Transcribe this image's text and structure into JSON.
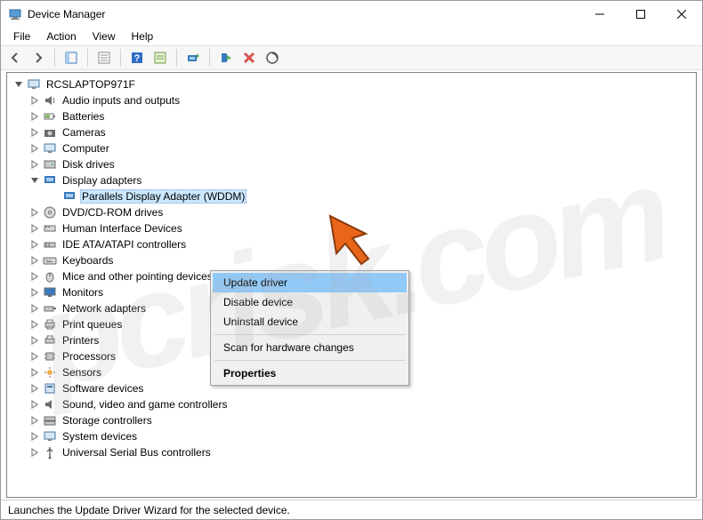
{
  "window": {
    "title": "Device Manager"
  },
  "menu": {
    "file": "File",
    "action": "Action",
    "view": "View",
    "help": "Help"
  },
  "tree": {
    "root": "RCSLAPTOP971F",
    "items": [
      "Audio inputs and outputs",
      "Batteries",
      "Cameras",
      "Computer",
      "Disk drives",
      "Display adapters",
      "DVD/CD-ROM drives",
      "Human Interface Devices",
      "IDE ATA/ATAPI controllers",
      "Keyboards",
      "Mice and other pointing devices",
      "Monitors",
      "Network adapters",
      "Print queues",
      "Printers",
      "Processors",
      "Sensors",
      "Software devices",
      "Sound, video and game controllers",
      "Storage controllers",
      "System devices",
      "Universal Serial Bus controllers"
    ],
    "display_child": "Parallels Display Adapter (WDDM)"
  },
  "context_menu": {
    "update": "Update driver",
    "disable": "Disable device",
    "uninstall": "Uninstall device",
    "scan": "Scan for hardware changes",
    "properties": "Properties"
  },
  "status": {
    "text": "Launches the Update Driver Wizard for the selected device."
  },
  "watermark": "pcrisk.com"
}
